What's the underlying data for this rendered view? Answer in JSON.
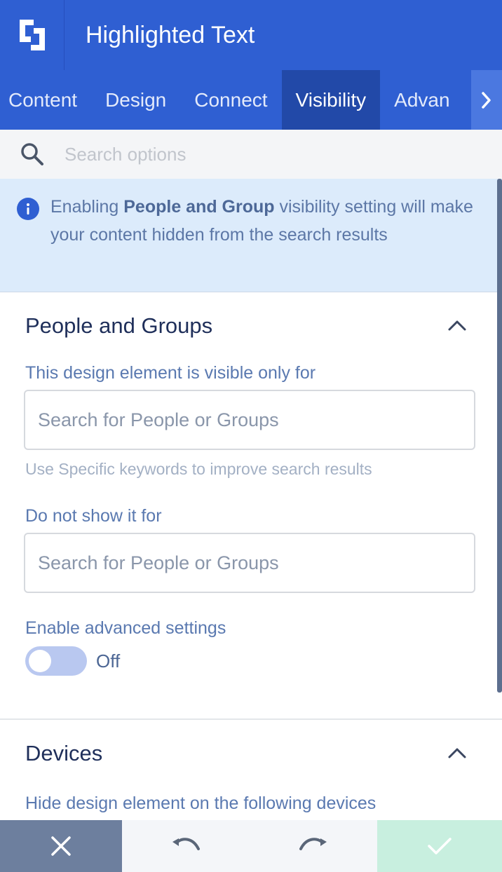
{
  "header": {
    "title": "Highlighted Text",
    "logo_icon": "builder-logo-icon"
  },
  "tabs": [
    {
      "label": "Content",
      "active": false
    },
    {
      "label": "Design",
      "active": false
    },
    {
      "label": "Connect",
      "active": false
    },
    {
      "label": "Visibility",
      "active": true
    },
    {
      "label": "Advan",
      "active": false
    }
  ],
  "search": {
    "placeholder": "Search options",
    "value": ""
  },
  "info": {
    "prefix": "Enabling ",
    "bold": "People and Group",
    "suffix": " visibility setting will make your content hidden from the search results"
  },
  "people_groups": {
    "title": "People and Groups",
    "visible_label": "This design element is visible only for",
    "visible_placeholder": "Search for People or Groups",
    "hint": "Use Specific keywords to improve search results",
    "hidden_label": "Do not show it for",
    "hidden_placeholder": "Search for People or Groups",
    "advanced_label": "Enable advanced settings",
    "toggle_state": "Off"
  },
  "devices": {
    "title": "Devices",
    "label": "Hide design element on the following devices"
  },
  "colors": {
    "header": "#2f5fd2",
    "tab_active": "#2249a8",
    "info_bg": "#dcebfb",
    "close_button": "#6d7f9e",
    "apply_button": "#c8efdf"
  }
}
